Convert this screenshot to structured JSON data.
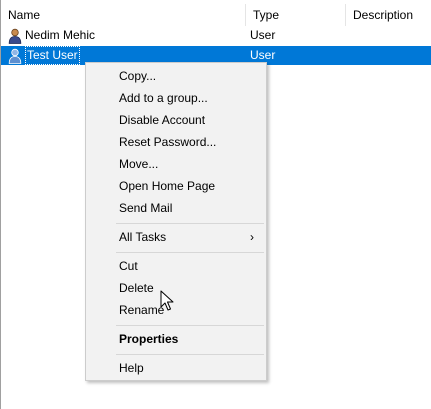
{
  "columns": {
    "name": "Name",
    "type": "Type",
    "description": "Description"
  },
  "rows": [
    {
      "name": "Nedim Mehic",
      "type": "User",
      "icon": "user-icon",
      "selected": false
    },
    {
      "name": "Test User",
      "type": "User",
      "icon": "user-icon",
      "selected": true
    }
  ],
  "context_menu": {
    "items": {
      "copy": "Copy...",
      "add_to_group": "Add to a group...",
      "disable_account": "Disable Account",
      "reset_password": "Reset Password...",
      "move": "Move...",
      "open_home_page": "Open Home Page",
      "send_mail": "Send Mail",
      "all_tasks": "All Tasks",
      "cut": "Cut",
      "delete": "Delete",
      "rename": "Rename",
      "properties": "Properties",
      "help": "Help"
    },
    "submenu_arrow": "›"
  },
  "colors": {
    "selection": "#0078d7",
    "menu_background": "#f2f2f2",
    "separator": "#d7d7d7"
  }
}
